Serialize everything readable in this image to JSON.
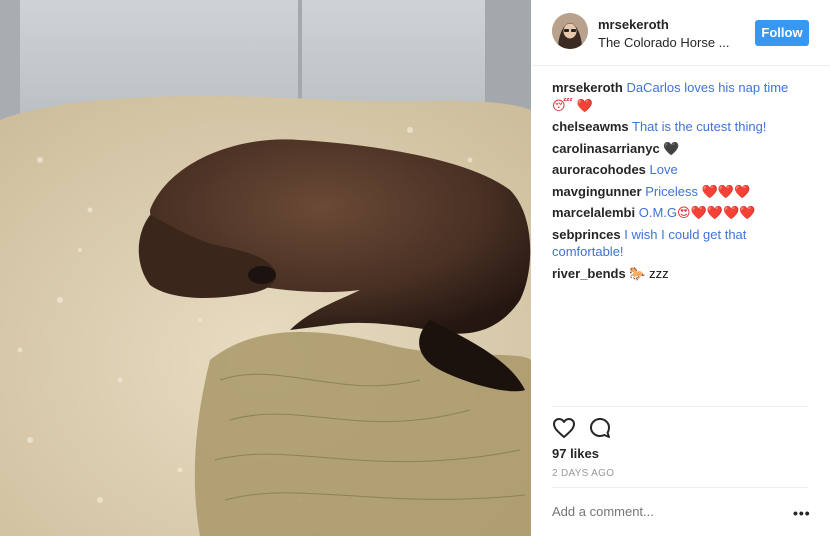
{
  "post": {
    "username": "mrsekeroth",
    "location": "The Colorado Horse ...",
    "follow_label": "Follow"
  },
  "photo": {
    "icon": "horse-photo"
  },
  "comments": [
    {
      "user": "mrsekeroth",
      "text": "DaCarlos loves his nap time",
      "emoji": "😴 ❤️"
    },
    {
      "user": "chelseawms",
      "text": "That is the cutest thing!",
      "emoji": ""
    },
    {
      "user": "carolinasarrianyc",
      "text": "",
      "emoji": "🖤"
    },
    {
      "user": "auroracohodes",
      "text": "Love",
      "emoji": ""
    },
    {
      "user": "mavgingunner",
      "text": "Priceless",
      "emoji": "❤️❤️❤️"
    },
    {
      "user": "marcelalembi",
      "text": "O.M.G",
      "emoji": "😍❤️❤️❤️❤️"
    },
    {
      "user": "sebprinces",
      "text": "I wish I could get that comfortable!",
      "emoji": ""
    },
    {
      "user": "river_bends",
      "text": "",
      "emoji": "🐎 zzz"
    }
  ],
  "actions": {
    "like_icon": "heart-icon",
    "comment_icon": "comment-bubble-icon"
  },
  "likes_label": "97 likes",
  "time_label": "2 DAYS AGO",
  "add_comment_placeholder": "Add a comment...",
  "more_label": "•••",
  "colors": {
    "accent": "#3897f0",
    "link": "#3f73d8",
    "muted": "#999999"
  }
}
